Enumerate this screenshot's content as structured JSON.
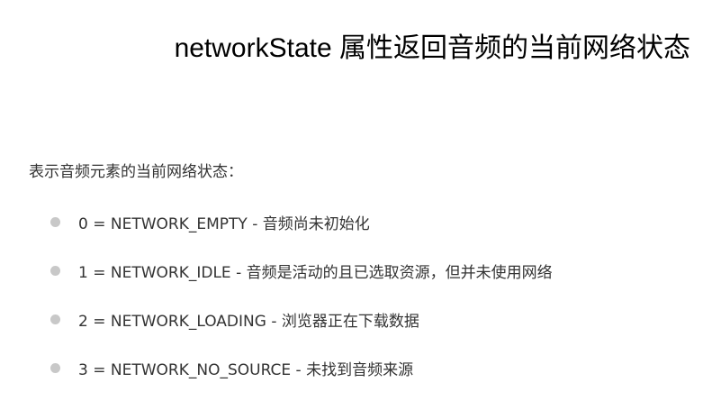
{
  "title": "networkState 属性返回音频的当前网络状态",
  "intro": "表示音频元素的当前网络状态：",
  "items": [
    "0 = NETWORK_EMPTY - 音频尚未初始化",
    "1 = NETWORK_IDLE - 音频是活动的且已选取资源，但并未使用网络",
    "2 = NETWORK_LOADING - 浏览器正在下载数据",
    "3 = NETWORK_NO_SOURCE - 未找到音频来源"
  ]
}
